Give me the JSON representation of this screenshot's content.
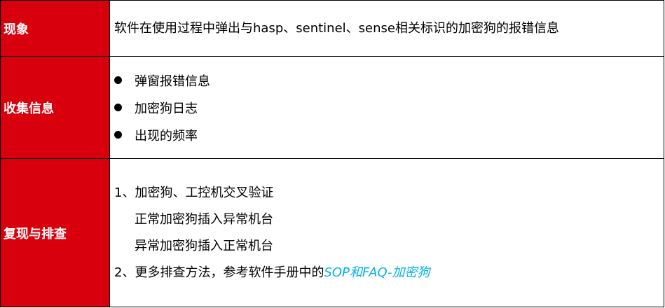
{
  "rows": {
    "phenomenon": {
      "label": "现象",
      "text": "软件在使用过程中弹出与hasp、sentinel、sense相关标识的加密狗的报错信息"
    },
    "collect": {
      "label": "收集信息",
      "items": [
        "弹窗报错信息",
        "加密狗日志",
        "出现的频率"
      ]
    },
    "reproduce": {
      "label": "复现与排查",
      "step1": "1、加密狗、工控机交叉验证",
      "sub1": "正常加密狗插入异常机台",
      "sub2": "异常加密狗插入正常机台",
      "step2_prefix": "2、更多排查方法，参考软件手册中的",
      "step2_link": "SOP和FAQ-加密狗"
    }
  },
  "colors": {
    "header_bg": "#d9000e",
    "header_text": "#ffffff",
    "link": "#00b0f0"
  }
}
